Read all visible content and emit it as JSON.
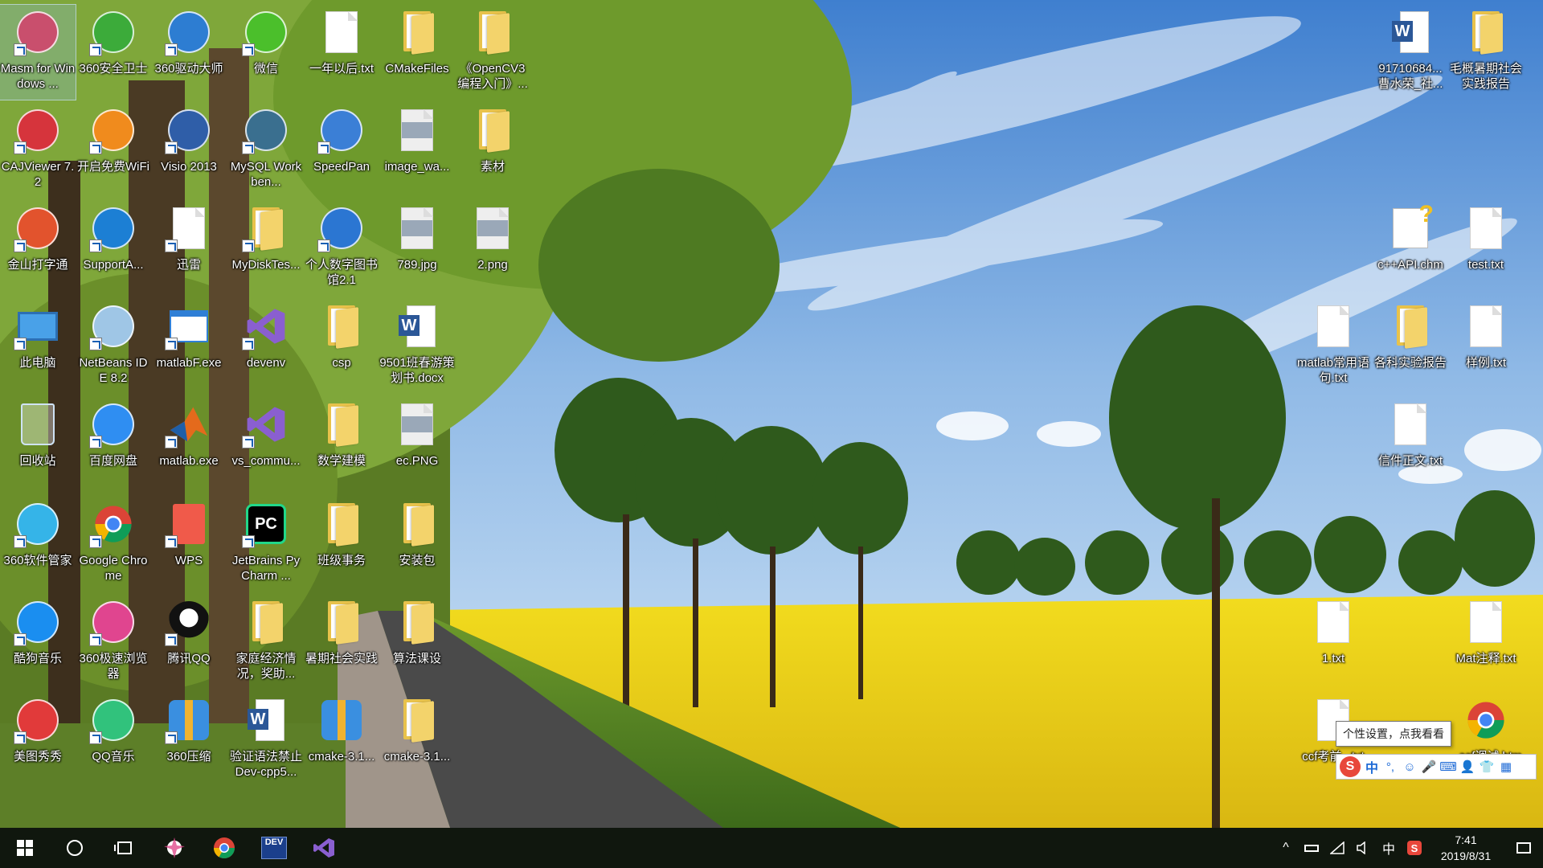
{
  "desktop": {
    "icons": [
      {
        "label": "Masm for Windows ...",
        "icon": "asm-app-icon",
        "shortcut": true,
        "selected": true
      },
      {
        "label": "360安全卫士",
        "icon": "360-security-icon",
        "shortcut": true
      },
      {
        "label": "360驱动大师",
        "icon": "360-driver-icon",
        "shortcut": true
      },
      {
        "label": "微信",
        "icon": "wechat-icon",
        "shortcut": true
      },
      {
        "label": "一年以后.txt",
        "icon": "text-file-icon",
        "shortcut": false
      },
      {
        "label": "CMakeFiles",
        "icon": "folder-icon",
        "shortcut": false
      },
      {
        "label": "《OpenCV3编程入门》...",
        "icon": "folder-icon",
        "shortcut": false
      },
      {
        "label": "CAJViewer 7.2",
        "icon": "cajviewer-icon",
        "shortcut": true
      },
      {
        "label": "开启免费WiFi",
        "icon": "wifi-icon",
        "shortcut": true
      },
      {
        "label": "Visio 2013",
        "icon": "visio-icon",
        "shortcut": true
      },
      {
        "label": "MySQL Workben...",
        "icon": "mysql-workbench-icon",
        "shortcut": true
      },
      {
        "label": "SpeedPan",
        "icon": "speedpan-icon",
        "shortcut": true
      },
      {
        "label": "image_wa...",
        "icon": "image-file-icon",
        "shortcut": false
      },
      {
        "label": "素材",
        "icon": "folder-icon",
        "shortcut": false
      },
      {
        "label": "金山打字通",
        "icon": "typing-app-icon",
        "shortcut": true
      },
      {
        "label": "SupportA...",
        "icon": "support-assist-icon",
        "shortcut": true
      },
      {
        "label": "迅雷",
        "icon": "text-file-icon",
        "shortcut": true
      },
      {
        "label": "MyDiskTes...",
        "icon": "folder-icon",
        "shortcut": true
      },
      {
        "label": "个人数字图书馆2.1",
        "icon": "digital-library-icon",
        "shortcut": true
      },
      {
        "label": "789.jpg",
        "icon": "image-file-icon",
        "shortcut": false
      },
      {
        "label": "2.png",
        "icon": "image-file-icon",
        "shortcut": false
      },
      {
        "label": "此电脑",
        "icon": "this-pc-icon",
        "shortcut": true
      },
      {
        "label": "NetBeans IDE 8.2",
        "icon": "netbeans-icon",
        "shortcut": true
      },
      {
        "label": "matlabF.exe",
        "icon": "window-app-icon",
        "shortcut": true
      },
      {
        "label": "devenv",
        "icon": "visual-studio-icon",
        "shortcut": true
      },
      {
        "label": "csp",
        "icon": "folder-icon",
        "shortcut": false
      },
      {
        "label": "9501班春游策划书.docx",
        "icon": "word-doc-icon",
        "shortcut": false
      },
      {
        "label": "回收站",
        "icon": "recycle-bin-icon",
        "shortcut": false
      },
      {
        "label": "百度网盘",
        "icon": "baidu-netdisk-icon",
        "shortcut": true
      },
      {
        "label": "matlab.exe",
        "icon": "matlab-icon",
        "shortcut": true
      },
      {
        "label": "vs_commu...",
        "icon": "visual-studio-icon",
        "shortcut": true
      },
      {
        "label": "数学建模",
        "icon": "folder-icon",
        "shortcut": false
      },
      {
        "label": "ec.PNG",
        "icon": "image-file-icon",
        "shortcut": false
      },
      {
        "label": "360软件管家",
        "icon": "360-software-icon",
        "shortcut": true
      },
      {
        "label": "Google Chrome",
        "icon": "chrome-icon",
        "shortcut": true
      },
      {
        "label": "WPS",
        "icon": "wps-icon",
        "shortcut": true
      },
      {
        "label": "JetBrains PyCharm ...",
        "icon": "pycharm-icon",
        "shortcut": true
      },
      {
        "label": "班级事务",
        "icon": "folder-icon",
        "shortcut": false
      },
      {
        "label": "安装包",
        "icon": "folder-icon",
        "shortcut": false
      },
      {
        "label": "酷狗音乐",
        "icon": "kugou-icon",
        "shortcut": true
      },
      {
        "label": "360极速浏览器",
        "icon": "360-browser-icon",
        "shortcut": true
      },
      {
        "label": "腾讯QQ",
        "icon": "qq-icon",
        "shortcut": true
      },
      {
        "label": "家庭经济情况，奖助...",
        "icon": "folder-icon",
        "shortcut": false
      },
      {
        "label": "暑期社会实践",
        "icon": "folder-icon",
        "shortcut": false
      },
      {
        "label": "算法课设",
        "icon": "folder-icon",
        "shortcut": false
      },
      {
        "label": "美图秀秀",
        "icon": "meitu-icon",
        "shortcut": true
      },
      {
        "label": "QQ音乐",
        "icon": "qq-music-icon",
        "shortcut": true
      },
      {
        "label": "360压缩",
        "icon": "360-zip-icon",
        "shortcut": true
      },
      {
        "label": "验证语法禁止Dev-cpp5...",
        "icon": "word-doc-icon",
        "shortcut": false
      },
      {
        "label": "cmake-3.1...",
        "icon": "archive-icon",
        "shortcut": false
      },
      {
        "label": "cmake-3.1...",
        "icon": "folder-icon",
        "shortcut": false
      },
      {
        "label": "91710684...曹水荣_社...",
        "icon": "word-doc-icon",
        "shortcut": false
      },
      {
        "label": "毛概暑期社会实践报告",
        "icon": "folder-icon",
        "shortcut": false
      },
      {
        "label": "c++API.chm",
        "icon": "chm-help-icon",
        "shortcut": false
      },
      {
        "label": "test.txt",
        "icon": "text-file-icon",
        "shortcut": false
      },
      {
        "label": "matlab常用语句.txt",
        "icon": "text-file-icon",
        "shortcut": false
      },
      {
        "label": "各科实验报告",
        "icon": "folder-icon",
        "shortcut": false
      },
      {
        "label": "样例.txt",
        "icon": "text-file-icon",
        "shortcut": false
      },
      {
        "label": "信件正文.txt",
        "icon": "text-file-icon",
        "shortcut": false
      },
      {
        "label": "1.txt",
        "icon": "text-file-icon",
        "shortcut": false
      },
      {
        "label": "Mat注释.txt",
        "icon": "text-file-icon",
        "shortcut": false
      },
      {
        "label": "ccf考前...txt",
        "icon": "text-file-icon",
        "shortcut": false
      },
      {
        "label": "...ccf调试.html",
        "icon": "chrome-html-icon",
        "shortcut": false
      }
    ]
  },
  "tooltip": {
    "text": "个性设置，点我看看"
  },
  "ime": {
    "logo": "S",
    "mode": "中",
    "punct": "°,",
    "emoji": "☺",
    "mic": "🎤",
    "keyboard": "⌨",
    "user": "👤",
    "shirt": "👕",
    "grid": "▦"
  },
  "taskbar": {
    "apps": [
      {
        "name": "360-browser-taskbar-icon"
      },
      {
        "name": "chrome-taskbar-icon"
      },
      {
        "name": "devcpp-taskbar-icon",
        "label": "DEV"
      },
      {
        "name": "visual-studio-taskbar-icon"
      }
    ],
    "tray": {
      "chevron": "^",
      "ime_lang": "中",
      "sogou": "S"
    },
    "clock": {
      "time": "7:41",
      "date": "2019/8/31"
    }
  }
}
